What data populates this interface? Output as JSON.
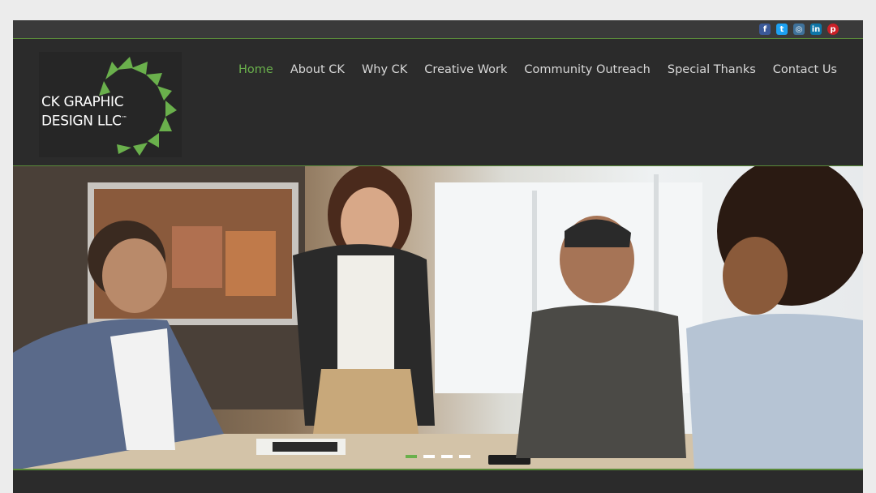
{
  "social": [
    {
      "icon": "facebook-icon",
      "glyph": "f",
      "color": "#3b5998"
    },
    {
      "icon": "twitter-icon",
      "glyph": "t",
      "color": "#1da1f2"
    },
    {
      "icon": "instagram-icon",
      "glyph": "◎",
      "color": "#3f729b"
    },
    {
      "icon": "linkedin-icon",
      "glyph": "in",
      "color": "#0e76a8"
    },
    {
      "icon": "pinterest-icon",
      "glyph": "p",
      "color": "#cb2027"
    }
  ],
  "logo": {
    "line1": "CK GRAPHIC",
    "line2": "DESIGN LLC",
    "tm": "™"
  },
  "nav": {
    "items": [
      {
        "label": "Home",
        "active": true
      },
      {
        "label": "About CK"
      },
      {
        "label": "Why CK"
      },
      {
        "label": "Creative Work"
      },
      {
        "label": "Community Outreach"
      },
      {
        "label": "Special Thanks"
      },
      {
        "label": "Contact Us"
      }
    ]
  },
  "slider": {
    "slide_count": 4,
    "active_index": 0
  },
  "colors": {
    "accent": "#6ab04c",
    "header_bg": "#2b2b2b"
  }
}
